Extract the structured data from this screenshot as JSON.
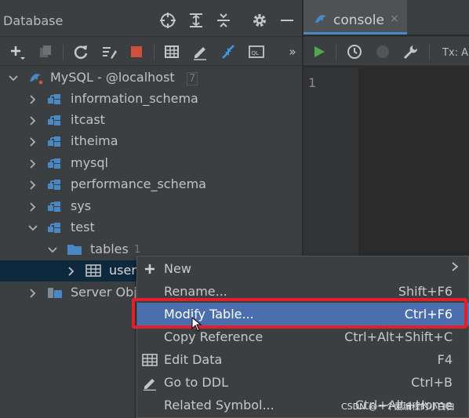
{
  "db_panel": {
    "title": "Database"
  },
  "tree": {
    "connection": {
      "label": "MySQL - @localhost",
      "count": "7"
    },
    "schemas": [
      {
        "label": "information_schema"
      },
      {
        "label": "itcast"
      },
      {
        "label": "itheima"
      },
      {
        "label": "mysql"
      },
      {
        "label": "performance_schema"
      },
      {
        "label": "sys"
      },
      {
        "label": "test"
      }
    ],
    "tables_folder": {
      "label": "tables",
      "count": "1"
    },
    "table_user": {
      "label": "user"
    },
    "server_objects": {
      "label": "Server Obj"
    }
  },
  "editor": {
    "tab_label": "console",
    "close_glyph": "×",
    "line_number": "1",
    "tx_label": "Tx: A"
  },
  "context_menu": {
    "items": [
      {
        "label": "New",
        "shortcut": "",
        "icon": "plus-icon",
        "submenu": true
      },
      {
        "label": "Rename...",
        "shortcut": "Shift+F6",
        "icon": ""
      },
      {
        "label": "Modify Table...",
        "shortcut": "Ctrl+F6",
        "icon": ""
      },
      {
        "label": "Copy Reference",
        "shortcut": "Ctrl+Alt+Shift+C",
        "icon": ""
      },
      {
        "label": "Edit Data",
        "shortcut": "F4",
        "icon": "table-icon"
      },
      {
        "label": "Go to DDL",
        "shortcut": "Ctrl+B",
        "icon": "edit-pencil-icon"
      },
      {
        "label": "Related Symbol...",
        "shortcut": "Ctrl+Alt+Home",
        "icon": ""
      }
    ],
    "highlight_color": "#e0202b",
    "selected_color": "#4b6eaf"
  },
  "watermark": "CSDN @一个爱编程的小白白"
}
